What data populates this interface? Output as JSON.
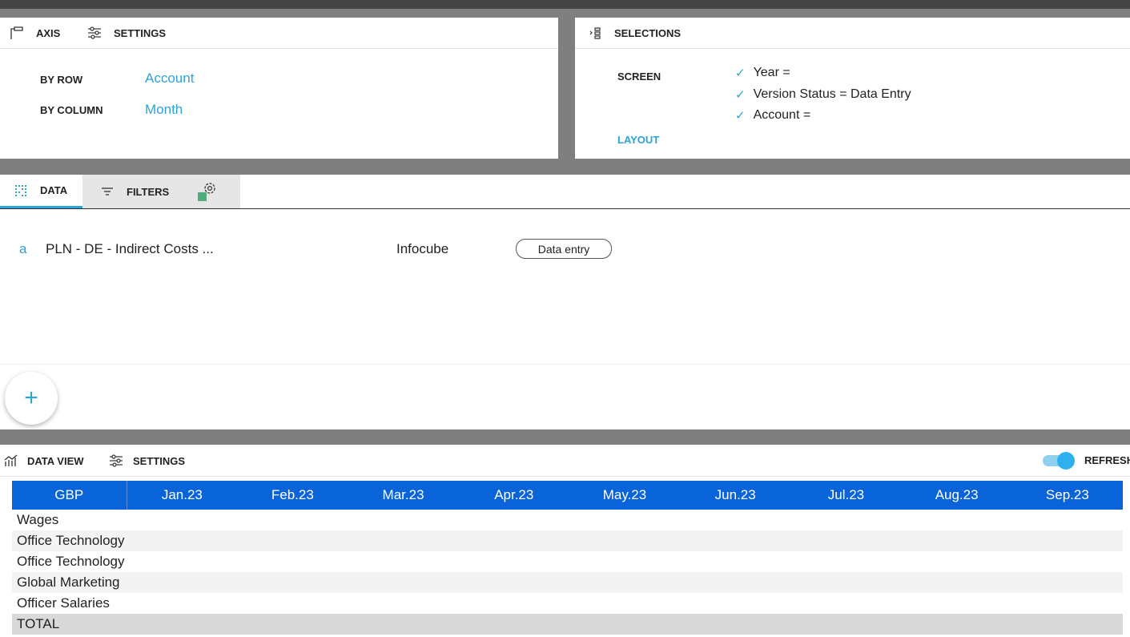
{
  "axis_panel": {
    "tab_axis": "AXIS",
    "tab_settings": "SETTINGS",
    "by_row_label": "BY ROW",
    "by_row_value": "Account",
    "by_column_label": "BY COLUMN",
    "by_column_value": "Month"
  },
  "selections_panel": {
    "title": "SELECTIONS",
    "screen_label": "SCREEN",
    "layout_label": "LAYOUT",
    "items": [
      "Year =",
      "Version Status = Data Entry",
      "Account ="
    ]
  },
  "data_panel": {
    "tab_data": "DATA",
    "tab_filters": "FILTERS",
    "source_letter": "a",
    "source_name": "PLN - DE - Indirect Costs ...",
    "source_type": "Infocube",
    "source_mode": "Data entry",
    "add_symbol": "+"
  },
  "data_view": {
    "tab_data_view": "DATA VIEW",
    "tab_settings": "SETTINGS",
    "refresh_label": "REFRESH",
    "refresh_on": true,
    "currency": "GBP",
    "columns": [
      "Jan.23",
      "Feb.23",
      "Mar.23",
      "Apr.23",
      "May.23",
      "Jun.23",
      "Jul.23",
      "Aug.23",
      "Sep.23"
    ],
    "rows": [
      "Wages",
      "Office Technology",
      "Office Technology",
      "Global Marketing",
      "Officer Salaries"
    ],
    "total_label": "TOTAL"
  },
  "colors": {
    "accent": "#2ea3d8",
    "header_blue": "#0a64d9",
    "status_green": "#4caf7d"
  }
}
